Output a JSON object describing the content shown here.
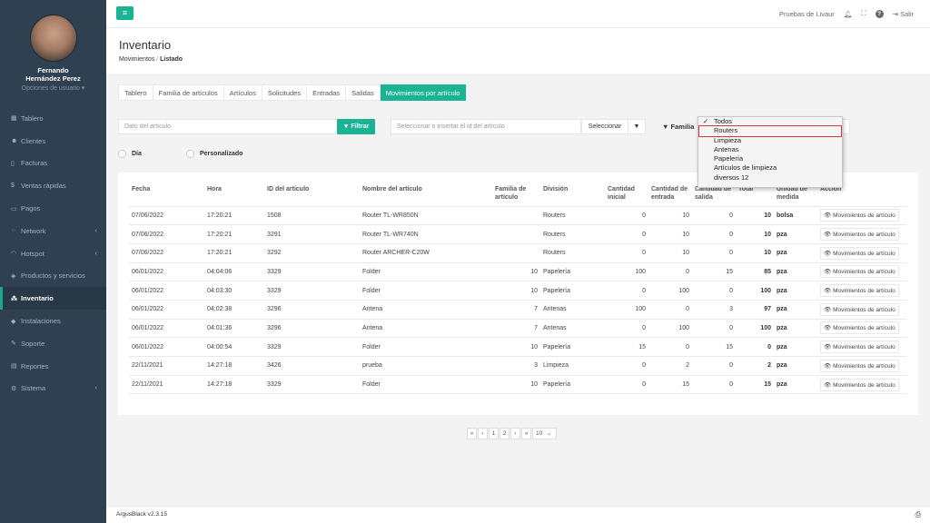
{
  "sidebar": {
    "user_name": "Fernando Hernández Perez",
    "user_options": "Opciones de usuario ▾",
    "items": [
      {
        "label": "Tablero",
        "icon": "dashboard-icon",
        "glyph": "▦"
      },
      {
        "label": "Clientes",
        "icon": "users-icon",
        "glyph": "☻"
      },
      {
        "label": "Facturas",
        "icon": "file-icon",
        "glyph": "▯"
      },
      {
        "label": "Ventas rápidas",
        "icon": "dollar-icon",
        "glyph": "$"
      },
      {
        "label": "Pagos",
        "icon": "money-icon",
        "glyph": "▭"
      },
      {
        "label": "Network",
        "icon": "network-icon",
        "glyph": "⁘",
        "chevron": true
      },
      {
        "label": "Hotspot",
        "icon": "wifi-icon",
        "glyph": "◠",
        "chevron": true
      },
      {
        "label": "Productos y servicios",
        "icon": "tag-icon",
        "glyph": "◈"
      },
      {
        "label": "Inventario",
        "icon": "cubes-icon",
        "glyph": "⁂",
        "active": true
      },
      {
        "label": "Instalaciones",
        "icon": "tools-icon",
        "glyph": "◆"
      },
      {
        "label": "Soporte",
        "icon": "wrench-icon",
        "glyph": "✎"
      },
      {
        "label": "Reportes",
        "icon": "book-icon",
        "glyph": "▤"
      },
      {
        "label": "Sistema",
        "icon": "gears-icon",
        "glyph": "⚙",
        "chevron": true
      }
    ]
  },
  "topbar": {
    "menu_glyph": "≡",
    "company": "Pruebas de Livaur",
    "logout": "Salir"
  },
  "heading": {
    "title": "Inventario",
    "crumb1": "Movimientos",
    "crumb_sep": "/",
    "crumb2": "Listado"
  },
  "tabs": [
    "Tablero",
    "Familia de artículos",
    "Artículos",
    "Solicitudes",
    "Entradas",
    "Salidas",
    "Movimientos por artículo"
  ],
  "filters": {
    "article_placeholder": "Dato del artículo",
    "filter_button": "Filtrar",
    "id_placeholder": "Seleccionar o insertar él id del artículo",
    "select_button": "Seleccionar",
    "family_label": "Familia",
    "radio_day": "Día",
    "radio_custom": "Personalizado"
  },
  "dropdown": {
    "options": [
      "Todos",
      "Routers",
      "Limpieza",
      "Antenas",
      "Papelería",
      "Artículos de limpieza",
      "diversos 12"
    ],
    "checked": "Todos",
    "highlighted": "Routers"
  },
  "table": {
    "headers": [
      "Fecha",
      "Hora",
      "ID del artículo",
      "Nombre del artículo",
      "Familia de artículo",
      "División",
      "Cantidad inicial",
      "Cantidad de entrada",
      "Cantidad de salida",
      "Total",
      "Unidad de medida",
      "Acción"
    ],
    "action_label": "Movimientos de artículo",
    "rows": [
      [
        "07/06/2022",
        "17:20:21",
        "1508",
        "Router TL-WR850N",
        "",
        "Routers",
        "0",
        "10",
        "0",
        "10",
        "bolsa"
      ],
      [
        "07/06/2022",
        "17:20:21",
        "3291",
        "Router TL-WR740N",
        "",
        "Routers",
        "0",
        "10",
        "0",
        "10",
        "pza"
      ],
      [
        "07/06/2022",
        "17:20:21",
        "3292",
        "Router ARCHER-C20W",
        "",
        "Routers",
        "0",
        "10",
        "0",
        "10",
        "pza"
      ],
      [
        "06/01/2022",
        "04:04:06",
        "3329",
        "Folder",
        "10",
        "Papelería",
        "100",
        "0",
        "15",
        "85",
        "pza"
      ],
      [
        "06/01/2022",
        "04:03:30",
        "3329",
        "Folder",
        "10",
        "Papelería",
        "0",
        "100",
        "0",
        "100",
        "pza"
      ],
      [
        "06/01/2022",
        "04:02:38",
        "3296",
        "Antena",
        "7",
        "Antenas",
        "100",
        "0",
        "3",
        "97",
        "pza"
      ],
      [
        "06/01/2022",
        "04:01:36",
        "3296",
        "Antena",
        "7",
        "Antenas",
        "0",
        "100",
        "0",
        "100",
        "pza"
      ],
      [
        "06/01/2022",
        "04:00:54",
        "3329",
        "Folder",
        "10",
        "Papelería",
        "15",
        "0",
        "15",
        "0",
        "pza"
      ],
      [
        "22/11/2021",
        "14:27:18",
        "3426",
        "prueba",
        "3",
        "Limpieza",
        "0",
        "2",
        "0",
        "2",
        "pza"
      ],
      [
        "22/11/2021",
        "14:27:18",
        "3329",
        "Folder",
        "10",
        "Papelería",
        "0",
        "15",
        "0",
        "15",
        "pza"
      ]
    ]
  },
  "pagination": {
    "items": [
      "«",
      "‹",
      "1",
      "2",
      "›",
      "»"
    ],
    "page_size": "10"
  },
  "footer": {
    "version": "ArgusBlack v2.3.15"
  },
  "colors": {
    "accent": "#1ab394",
    "sidebar": "#2f4050",
    "highlight_border": "#d9363e"
  }
}
